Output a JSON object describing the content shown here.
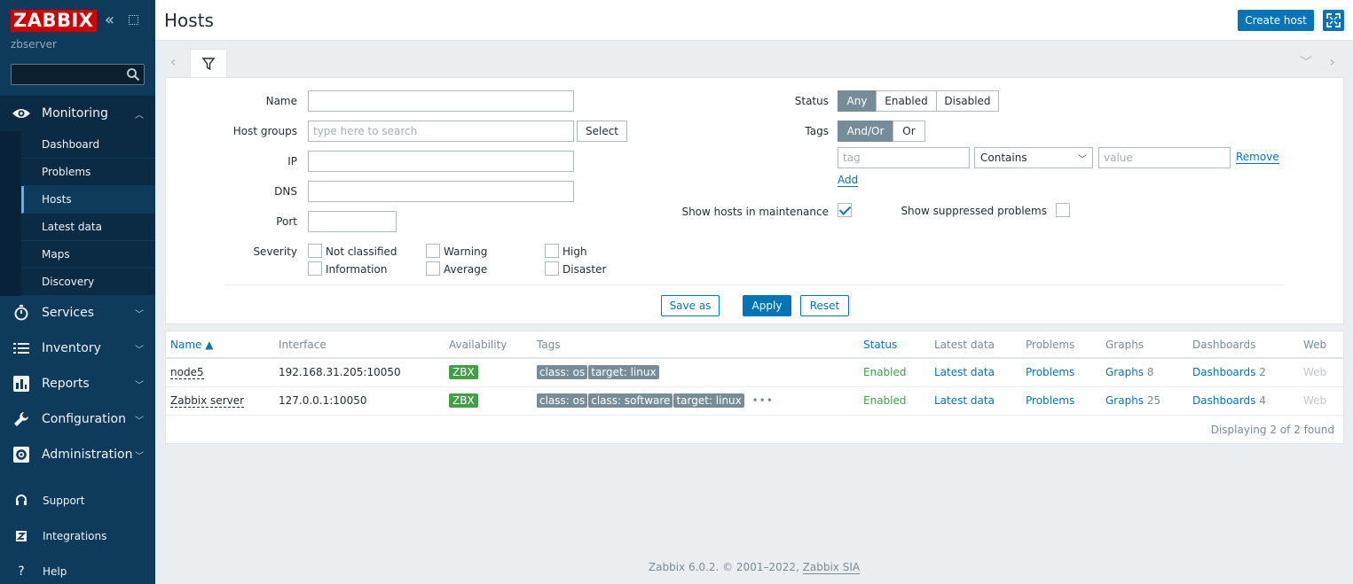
{
  "sidebar": {
    "logo": "ZABBIX",
    "server_name": "zbserver",
    "search_placeholder": "",
    "menu": [
      {
        "label": "Monitoring",
        "icon": "eye-icon"
      },
      {
        "label": "Services",
        "icon": "stopwatch-icon"
      },
      {
        "label": "Inventory",
        "icon": "list-icon"
      },
      {
        "label": "Reports",
        "icon": "bar-chart-icon"
      },
      {
        "label": "Configuration",
        "icon": "wrench-icon"
      },
      {
        "label": "Administration",
        "icon": "gear-icon"
      }
    ],
    "submenu": [
      "Dashboard",
      "Problems",
      "Hosts",
      "Latest data",
      "Maps",
      "Discovery"
    ],
    "bottom": [
      {
        "label": "Support",
        "icon": "headset-icon"
      },
      {
        "label": "Integrations",
        "icon": "zabbix-z-icon"
      },
      {
        "label": "Help",
        "icon": "question-icon"
      }
    ]
  },
  "header": {
    "title": "Hosts",
    "create_host": "Create host"
  },
  "filter": {
    "name_label": "Name",
    "host_groups_label": "Host groups",
    "host_groups_placeholder": "type here to search",
    "select_button": "Select",
    "ip_label": "IP",
    "dns_label": "DNS",
    "port_label": "Port",
    "severity_label": "Severity",
    "severities": [
      "Not classified",
      "Warning",
      "High",
      "Information",
      "Average",
      "Disaster"
    ],
    "status_label": "Status",
    "status_options": [
      "Any",
      "Enabled",
      "Disabled"
    ],
    "status_selected": "Any",
    "tags_label": "Tags",
    "tags_options": [
      "And/Or",
      "Or"
    ],
    "tag_placeholder": "tag",
    "tag_operator": "Contains",
    "value_placeholder": "value",
    "remove_link": "Remove",
    "add_link": "Add",
    "maintenance_label": "Show hosts in maintenance",
    "maintenance_checked": true,
    "suppressed_label": "Show suppressed problems",
    "suppressed_checked": false,
    "save_as": "Save as",
    "apply": "Apply",
    "reset": "Reset"
  },
  "table": {
    "columns": [
      "Name ▲",
      "Interface",
      "Availability",
      "Tags",
      "Status",
      "Latest data",
      "Problems",
      "Graphs",
      "Dashboards",
      "Web"
    ],
    "rows": [
      {
        "name": "node5",
        "interface": "192.168.31.205:10050",
        "availability": "ZBX",
        "tags": [
          "class: os",
          "target: linux"
        ],
        "more_tags": "",
        "status": "Enabled",
        "latest_data": "Latest data",
        "problems": "Problems",
        "graphs": "Graphs",
        "graphs_count": "8",
        "dashboards": "Dashboards",
        "dashboards_count": "2",
        "web": "Web"
      },
      {
        "name": "Zabbix server",
        "interface": "127.0.0.1:10050",
        "availability": "ZBX",
        "tags": [
          "class: os",
          "class: software",
          "target: linux"
        ],
        "more_tags": "•••",
        "status": "Enabled",
        "latest_data": "Latest data",
        "problems": "Problems",
        "graphs": "Graphs",
        "graphs_count": "25",
        "dashboards": "Dashboards",
        "dashboards_count": "4",
        "web": "Web"
      }
    ],
    "footer": "Displaying 2 of 2 found"
  },
  "footer": {
    "text": "Zabbix 6.0.2. © 2001–2022,",
    "link": "Zabbix SIA"
  },
  "colors": {
    "sidebar_bg": "#0e3a5c",
    "brand_red": "#d40000",
    "accent": "#0275b8",
    "enabled_green": "#429e47",
    "tag_grey": "#768d99"
  }
}
